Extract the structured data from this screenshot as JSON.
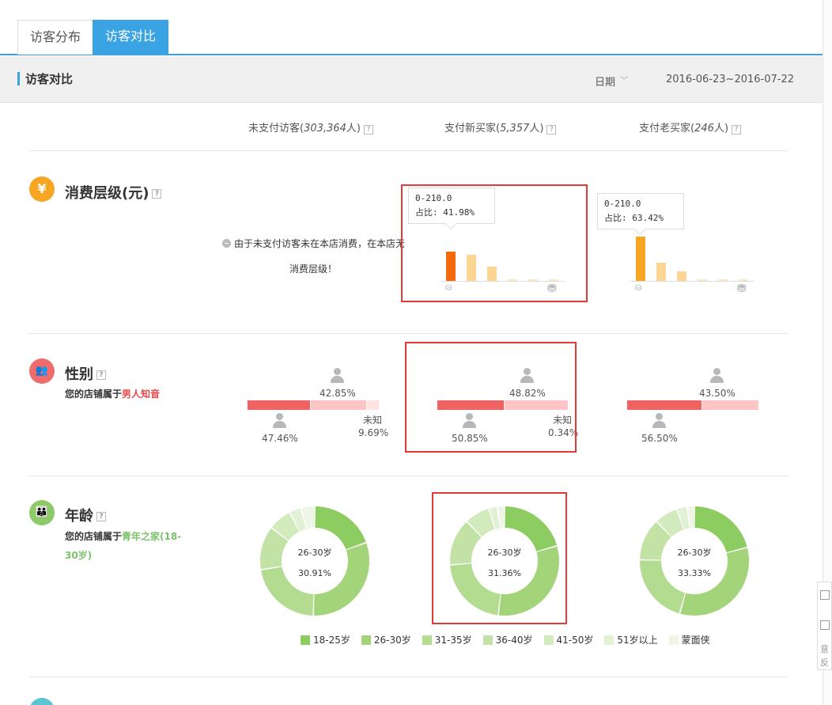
{
  "tabs": [
    {
      "label": "访客分布",
      "active": false
    },
    {
      "label": "访客对比",
      "active": true
    }
  ],
  "header": {
    "title": "访客对比",
    "date_label": "日期",
    "date_range": "2016-06-23~2016-07-22"
  },
  "columns": [
    {
      "label": "未支付访客",
      "count": "303,364",
      "unit": "人"
    },
    {
      "label": "支付新买家",
      "count": "5,357",
      "unit": "人"
    },
    {
      "label": "支付老买家",
      "count": "246",
      "unit": "人"
    }
  ],
  "help_mark": "?",
  "side_widget": [
    "意",
    "反"
  ],
  "sections": {
    "spend": {
      "icon": "¥",
      "title": "消费层级(元)",
      "notice_line1": "由于未支付访客未在本店消费，在本店无",
      "notice_line2": "消费层级！",
      "new_buyers": {
        "tooltip_range": "0-210.0",
        "tooltip_share": "占比: 41.98%",
        "values": [
          41.98,
          37.0,
          20.5,
          1.2,
          1.0,
          1.5
        ]
      },
      "old_buyers": {
        "tooltip_range": "0-210.0",
        "tooltip_share": "占比: 63.42%",
        "values": [
          63.42,
          26.0,
          14.0,
          1.2,
          1.0,
          1.5
        ]
      }
    },
    "gender": {
      "title": "性别",
      "sub_prefix": "您的店铺属于",
      "sub_highlight": "男人知音",
      "unknown_label": "未知",
      "groups": [
        {
          "male": "47.46%",
          "female": "42.85%",
          "unknown": "9.69%",
          "male_v": 47.46,
          "female_v": 42.85,
          "unknown_v": 9.69
        },
        {
          "male": "50.85%",
          "female": "48.82%",
          "unknown": "0.34%",
          "male_v": 50.85,
          "female_v": 48.82,
          "unknown_v": 0.34
        },
        {
          "male": "56.50%",
          "female": "43.50%",
          "unknown": "",
          "male_v": 56.5,
          "female_v": 43.5,
          "unknown_v": 0
        }
      ]
    },
    "age": {
      "title": "年龄",
      "sub_prefix": "您的店铺属于",
      "sub_highlight": "青年之家(18-30岁)",
      "donuts": [
        {
          "center_label": "26-30岁",
          "center_value": "30.91%",
          "values": [
            19.5,
            30.91,
            22.0,
            13.0,
            7.0,
            3.5,
            4.09
          ]
        },
        {
          "center_label": "26-30岁",
          "center_value": "31.36%",
          "values": [
            20.5,
            31.36,
            22.0,
            14.0,
            7.5,
            2.5,
            2.14
          ]
        },
        {
          "center_label": "26-30岁",
          "center_value": "33.33%",
          "values": [
            21.0,
            33.33,
            21.0,
            12.5,
            7.0,
            3.0,
            2.17
          ]
        }
      ],
      "legend": [
        {
          "label": "18-25岁",
          "color": "#8dcc60"
        },
        {
          "label": "26-30岁",
          "color": "#a3d47a"
        },
        {
          "label": "31-35岁",
          "color": "#b3dc90"
        },
        {
          "label": "36-40岁",
          "color": "#c3e3a6"
        },
        {
          "label": "41-50岁",
          "color": "#d3eabd"
        },
        {
          "label": "51岁以上",
          "color": "#e2f0d4"
        },
        {
          "label": "蒙面侠",
          "color": "#eef6e6"
        }
      ]
    }
  },
  "colors": {
    "accent_blue": "#3aa3e3",
    "spend_icon": "#f5a623",
    "gender_icon": "#f06b6b",
    "age_icon": "#8ccb67",
    "male_bar": "#f06262",
    "female_bar": "#ffc4c4",
    "unknown_bar": "#ffe3e3",
    "bar_active": "#f26a0a",
    "bar_orange": "#f5a623",
    "bar_light": "#fdd592",
    "bar_faint": "#fde8c4",
    "highlight_box": "#e53935"
  }
}
